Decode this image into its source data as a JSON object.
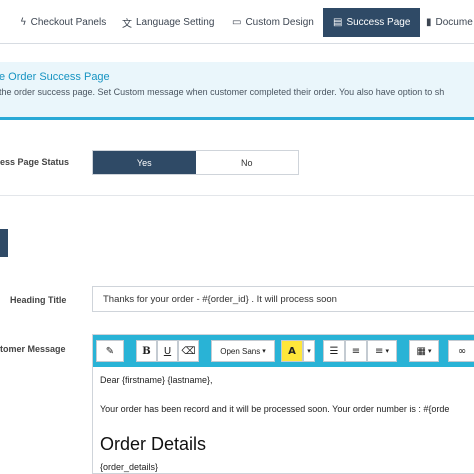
{
  "tabs": [
    {
      "label": "Checkout Panels",
      "icon": "bolt-icon",
      "active": false
    },
    {
      "label": "Language Setting",
      "icon": "translate-icon",
      "active": false
    },
    {
      "label": "Custom Design",
      "icon": "monitor-icon",
      "active": false
    },
    {
      "label": "Success Page",
      "icon": "file-icon",
      "active": true
    },
    {
      "label": "Docume",
      "icon": "book-icon",
      "active": false
    }
  ],
  "banner": {
    "title": "e Order Success Page",
    "description": "the order success page. Set Custom message when customer completed their order. You also have option to sh"
  },
  "status": {
    "label": "ess Page Status",
    "options": [
      "Yes",
      "No"
    ],
    "selected": "Yes"
  },
  "heading": {
    "label": "Heading Title",
    "value": "Thanks for your order - #{order_id} . It will process soon"
  },
  "message": {
    "label": "tomer Message",
    "toolbar": {
      "font_name": "Open Sans"
    },
    "lines": [
      "Dear {firstname} {lastname},",
      "Your order has been record and it will be processed soon. Your order number is : #{orde",
      "Order Details",
      "{order_details}"
    ]
  },
  "colors": {
    "accent": "#29b3d6",
    "active_tab": "#2f4a66",
    "banner_bg": "#eaf6fb",
    "banner_title": "#1794c2"
  }
}
